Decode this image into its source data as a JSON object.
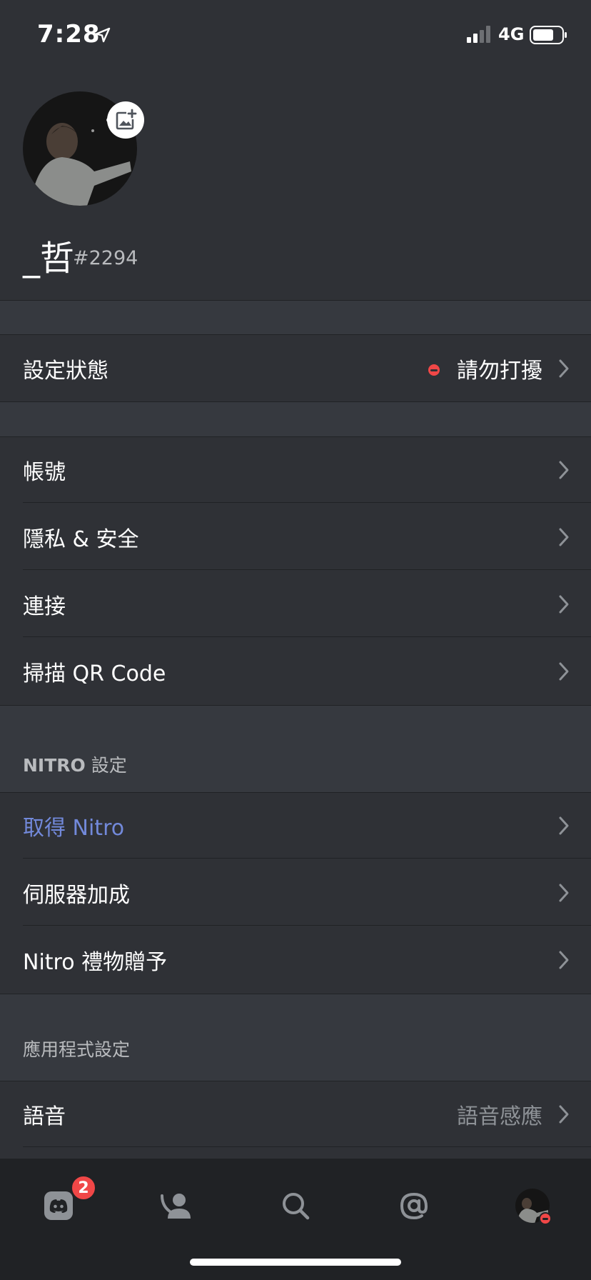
{
  "status_bar": {
    "time": "7:28",
    "network": "4G"
  },
  "profile": {
    "username": "_哲",
    "tag": "#2294"
  },
  "status_row": {
    "label": "設定狀態",
    "value": "請勿打擾",
    "status_color": "#f04747"
  },
  "account_section": {
    "items": [
      {
        "label": "帳號"
      },
      {
        "label": "隱私 & 安全"
      },
      {
        "label": "連接"
      },
      {
        "label": "掃描 QR Code"
      }
    ]
  },
  "nitro_section": {
    "header_bold": "NITRO",
    "header_rest": " 設定",
    "items": [
      {
        "label": "取得 Nitro",
        "color": "#7289da"
      },
      {
        "label": "伺服器加成"
      },
      {
        "label": "Nitro 禮物贈予"
      }
    ]
  },
  "app_section": {
    "header": "應用程式設定",
    "items": [
      {
        "label": "語音",
        "value": "語音感應"
      }
    ]
  },
  "tabbar": {
    "icons": [
      "discord-home-icon",
      "friends-icon",
      "search-icon",
      "mentions-icon",
      "profile-avatar"
    ],
    "home_badge": "2"
  }
}
